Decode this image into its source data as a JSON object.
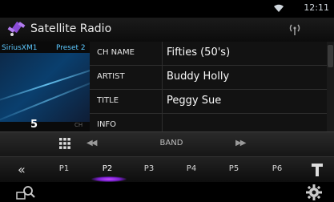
{
  "status": {
    "time": "12:11",
    "wifi_icon": "wifi-icon"
  },
  "title": {
    "text": "Satellite Radio",
    "icon": "satellite-radio-icon",
    "antenna_icon": "antenna-icon"
  },
  "channel": {
    "band": "SiriusXM1",
    "preset": "Preset 2",
    "number": "5",
    "number_suffix": "CH"
  },
  "info_rows": [
    {
      "label": "CH NAME",
      "value": "Fifties (50's)"
    },
    {
      "label": "ARTIST",
      "value": "Buddy Holly"
    },
    {
      "label": "TITLE",
      "value": "Peggy Sue"
    },
    {
      "label": "INFO",
      "value": ""
    }
  ],
  "controls": {
    "prev_label": "◀◀",
    "band_label": "BAND",
    "next_label": "▶▶",
    "back_label": "«",
    "presets": [
      "P1",
      "P2",
      "P3",
      "P4",
      "P5",
      "P6"
    ],
    "active_preset": "P2"
  },
  "colors": {
    "accent": "#5cc8ff",
    "active_glow": "#b040ff"
  }
}
